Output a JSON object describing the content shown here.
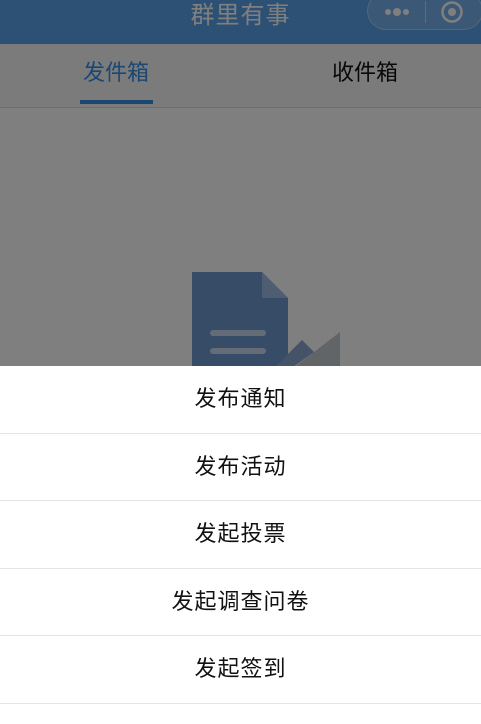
{
  "nav": {
    "title": "群里有事",
    "icons": [
      "more-icon",
      "target-icon"
    ],
    "background": "#5aa2e8"
  },
  "tabs": [
    {
      "label": "发件箱",
      "active": true
    },
    {
      "label": "收件箱",
      "active": false
    }
  ],
  "accent_color": "#3a8ee6",
  "action_sheet": {
    "items": [
      {
        "label": "发布通知"
      },
      {
        "label": "发布活动"
      },
      {
        "label": "发起投票"
      },
      {
        "label": "发起调查问卷"
      },
      {
        "label": "发起签到"
      }
    ]
  }
}
